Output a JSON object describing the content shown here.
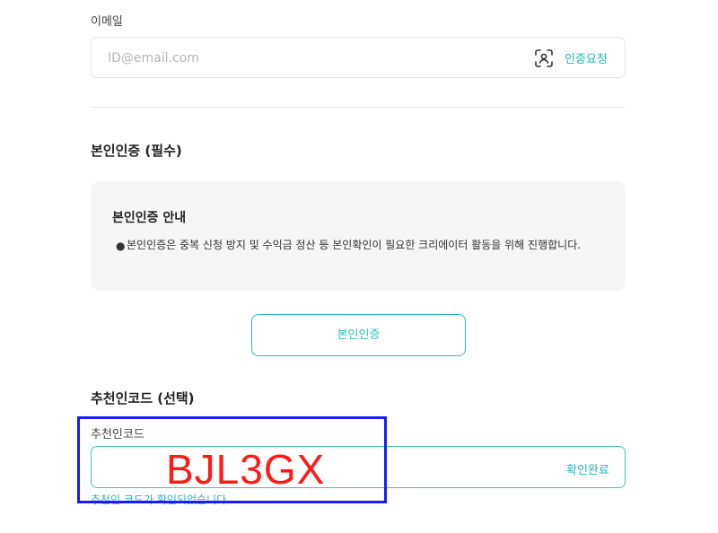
{
  "email": {
    "label": "이메일",
    "placeholder": "ID@email.com",
    "verify_request_label": "인증요청",
    "icon": "face-scan-icon"
  },
  "identity": {
    "section_title": "본인인증 (필수)",
    "notice_title": "본인인증 안내",
    "notice_text": "본인인증은 중복 신청 방지 및 수익금 정산 등 본인확인이 필요한 크리에이터 활동을 위해 진행합니다.",
    "button_label": "본인인증"
  },
  "referral": {
    "section_title": "추천인코드 (선택)",
    "field_label": "추천인코드",
    "confirm_label": "확인완료",
    "value": "BJL3GX",
    "success_message": "추천인 코드가 확인되었습니다"
  },
  "colors": {
    "accent": "#2fbcb6",
    "overlay_text": "#ff1a1a",
    "highlight_border": "#1a1aff"
  }
}
